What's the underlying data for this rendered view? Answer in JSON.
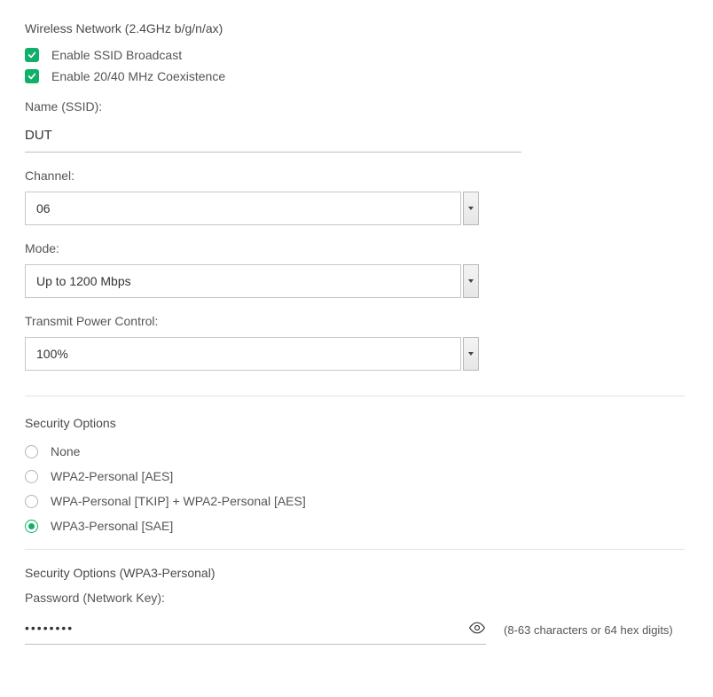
{
  "header": {
    "title": "Wireless Network (2.4GHz b/g/n/ax)"
  },
  "checkboxes": {
    "ssid_broadcast": {
      "label": "Enable SSID Broadcast",
      "checked": true
    },
    "coexistence": {
      "label": "Enable 20/40 MHz Coexistence",
      "checked": true
    }
  },
  "ssid": {
    "label": "Name (SSID):",
    "value": "DUT"
  },
  "channel": {
    "label": "Channel:",
    "value": "06"
  },
  "mode": {
    "label": "Mode:",
    "value": "Up to 1200 Mbps"
  },
  "txpower": {
    "label": "Transmit Power Control:",
    "value": "100%"
  },
  "security": {
    "heading": "Security Options",
    "options": [
      {
        "id": "none",
        "label": "None",
        "selected": false
      },
      {
        "id": "wpa2",
        "label": "WPA2-Personal [AES]",
        "selected": false
      },
      {
        "id": "mixed",
        "label": "WPA-Personal [TKIP] + WPA2-Personal [AES]",
        "selected": false
      },
      {
        "id": "wpa3",
        "label": "WPA3-Personal [SAE]",
        "selected": true
      }
    ],
    "subheading": "Security Options (WPA3-Personal)",
    "password_label": "Password (Network Key):",
    "password_masked": "••••••••",
    "password_hint": "(8-63 characters or 64 hex digits)"
  }
}
